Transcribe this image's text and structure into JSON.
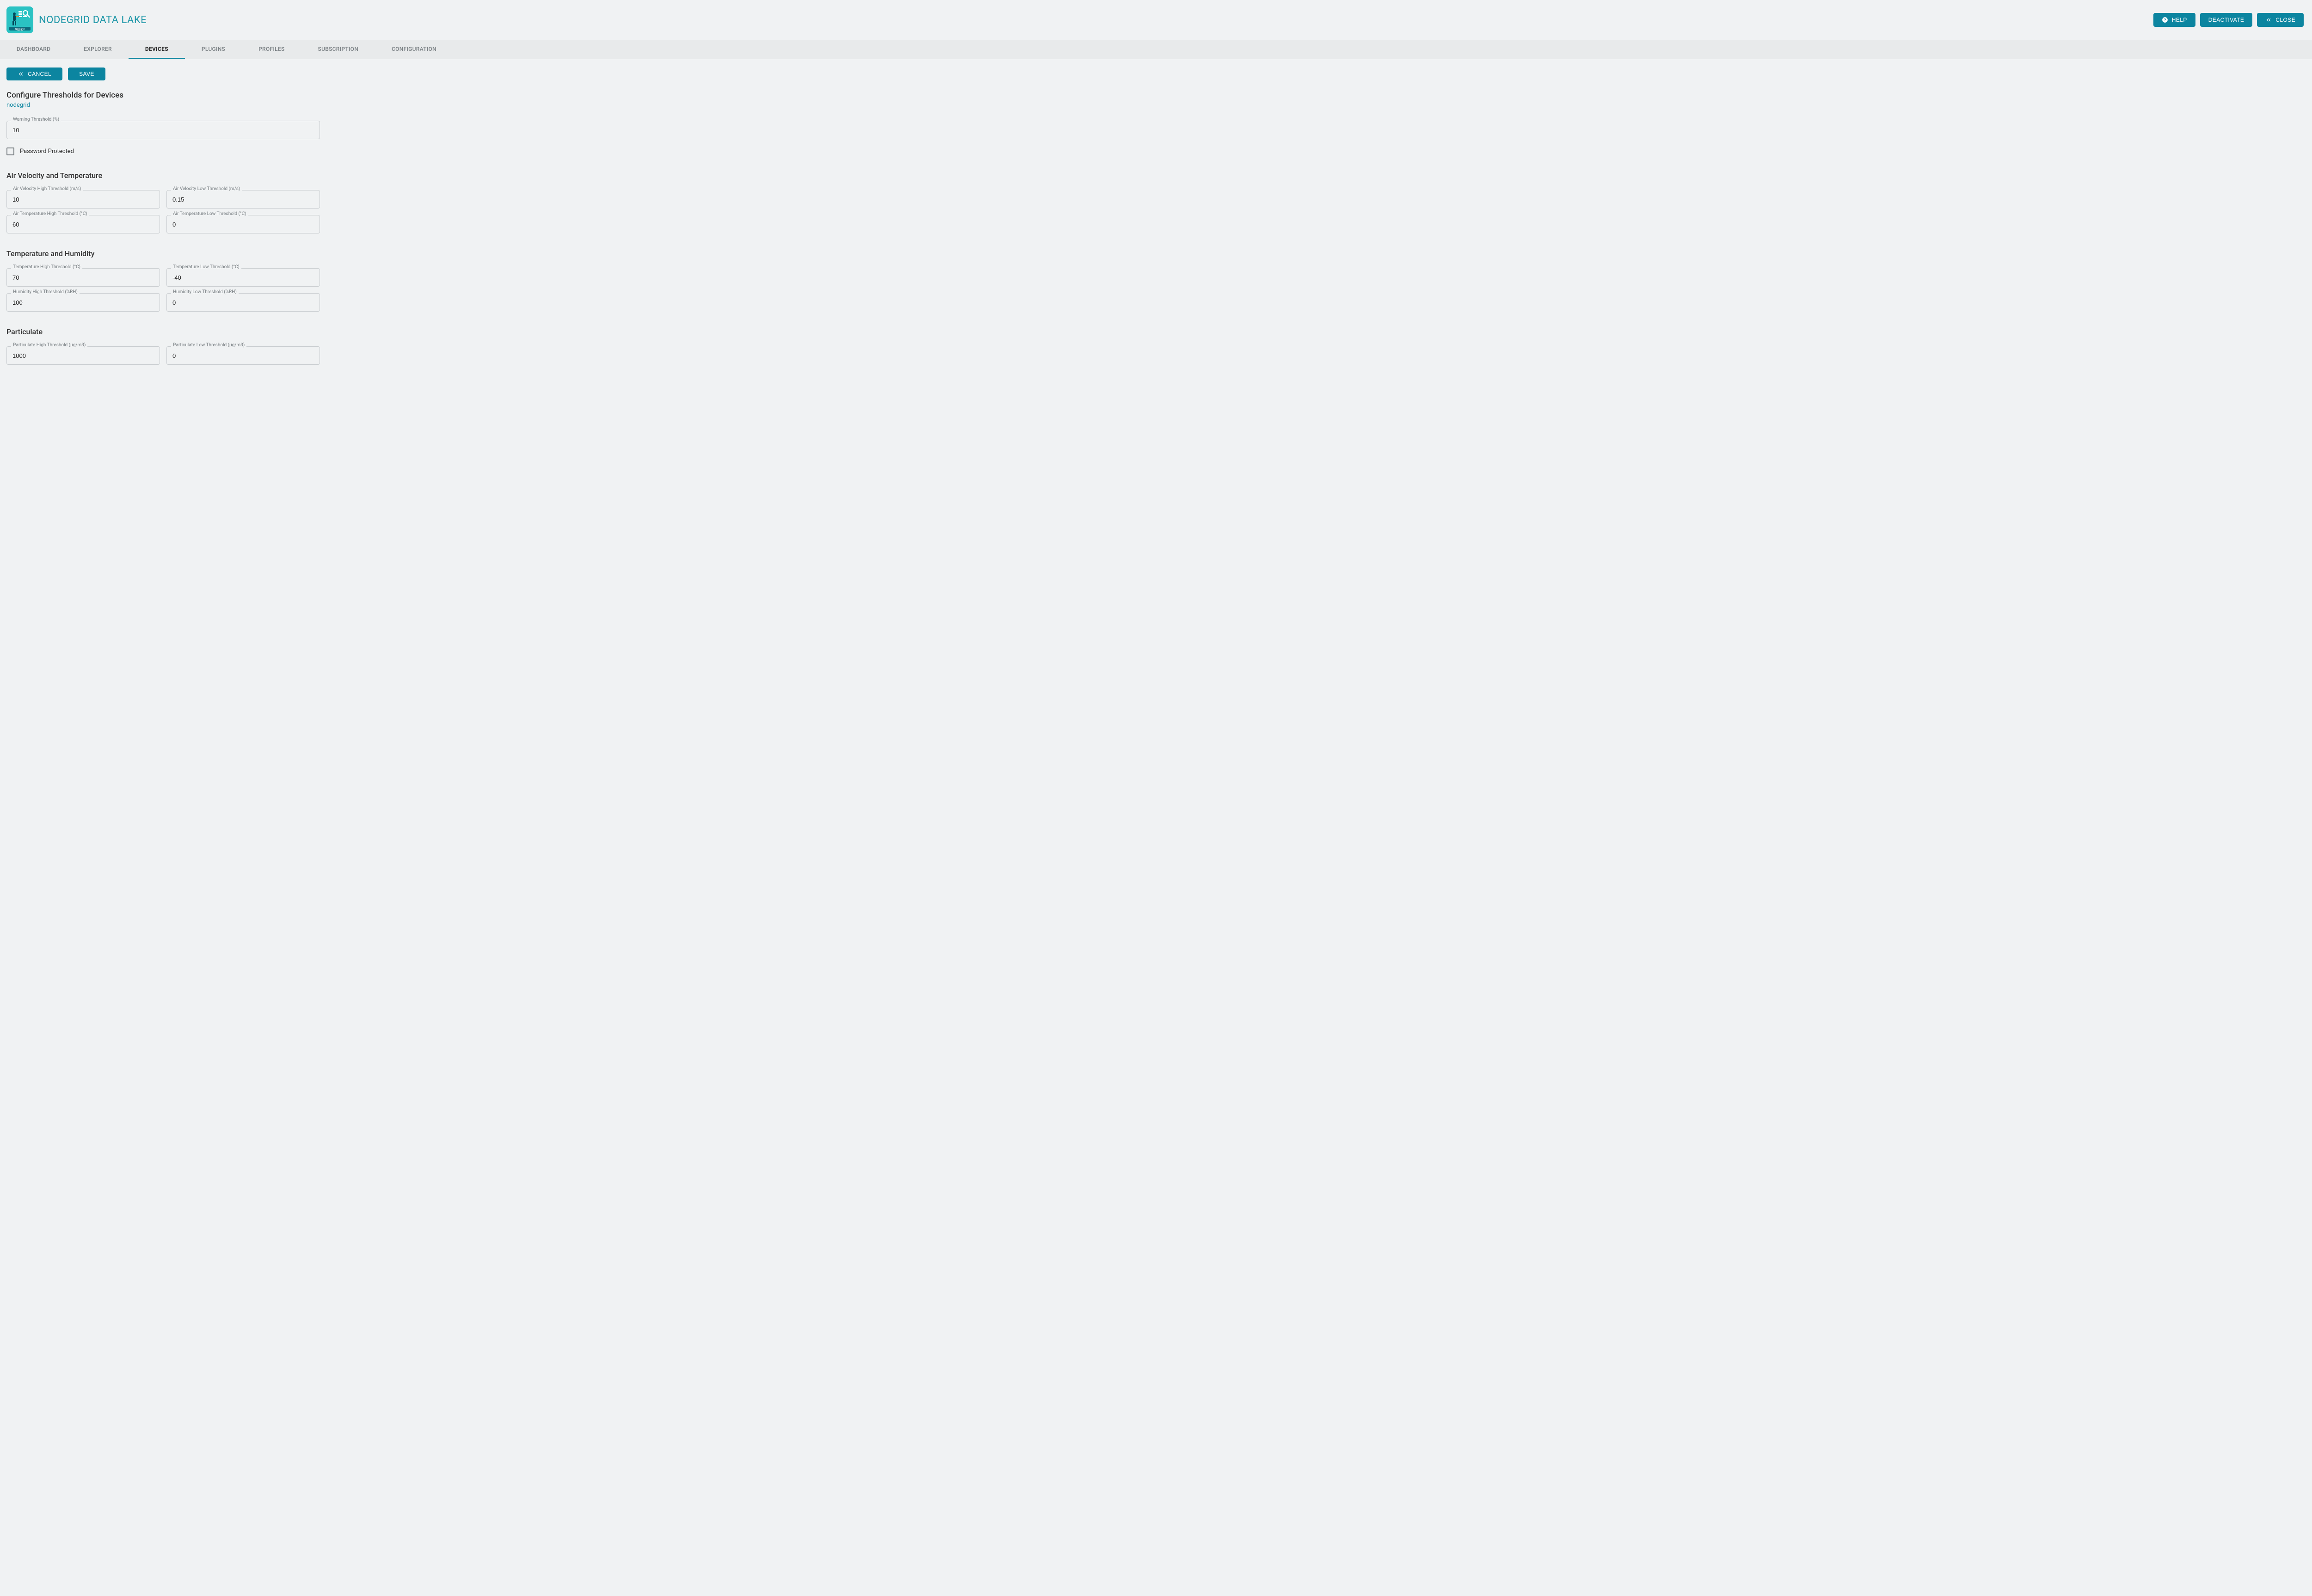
{
  "brand": {
    "title": "NODEGRID DATA LAKE"
  },
  "header": {
    "help": "HELP",
    "deactivate": "DEACTIVATE",
    "close": "CLOSE"
  },
  "tabs": [
    {
      "label": "DASHBOARD",
      "active": false
    },
    {
      "label": "EXPLORER",
      "active": false
    },
    {
      "label": "DEVICES",
      "active": true
    },
    {
      "label": "PLUGINS",
      "active": false
    },
    {
      "label": "PROFILES",
      "active": false
    },
    {
      "label": "SUBSCRIPTION",
      "active": false
    },
    {
      "label": "CONFIGURATION",
      "active": false
    }
  ],
  "actions": {
    "cancel": "CANCEL",
    "save": "SAVE"
  },
  "page": {
    "title": "Configure Thresholds for Devices",
    "subtitle": "nodegrid"
  },
  "fields": {
    "warning_threshold": {
      "label": "Warning Threshold (%)",
      "value": "10"
    },
    "password_protected": {
      "label": "Password Protected",
      "checked": false
    }
  },
  "sections": {
    "air": {
      "title": "Air Velocity and Temperature",
      "air_vel_high": {
        "label": "Air Velocity High Threshold (m/s)",
        "value": "10"
      },
      "air_vel_low": {
        "label": "Air Velocity Low Threshold (m/s)",
        "value": "0.15"
      },
      "air_temp_high": {
        "label": "Air Temperature High Threshold (°C)",
        "value": "60"
      },
      "air_temp_low": {
        "label": "Air Temperature Low Threshold (°C)",
        "value": "0"
      }
    },
    "temp_hum": {
      "title": "Temperature and Humidity",
      "temp_high": {
        "label": "Temperature High Threshold (°C)",
        "value": "70"
      },
      "temp_low": {
        "label": "Temperature Low Threshold (°C)",
        "value": "-40"
      },
      "hum_high": {
        "label": "Humidity High Threshold (%RH)",
        "value": "100"
      },
      "hum_low": {
        "label": "Humidity Low Threshold (%RH)",
        "value": "0"
      }
    },
    "particulate": {
      "title": "Particulate",
      "part_high": {
        "label": "Particulate High Threshold (µg/m3)",
        "value": "1000"
      },
      "part_low": {
        "label": "Particulate Low Threshold (µg/m3)",
        "value": "0"
      }
    }
  }
}
